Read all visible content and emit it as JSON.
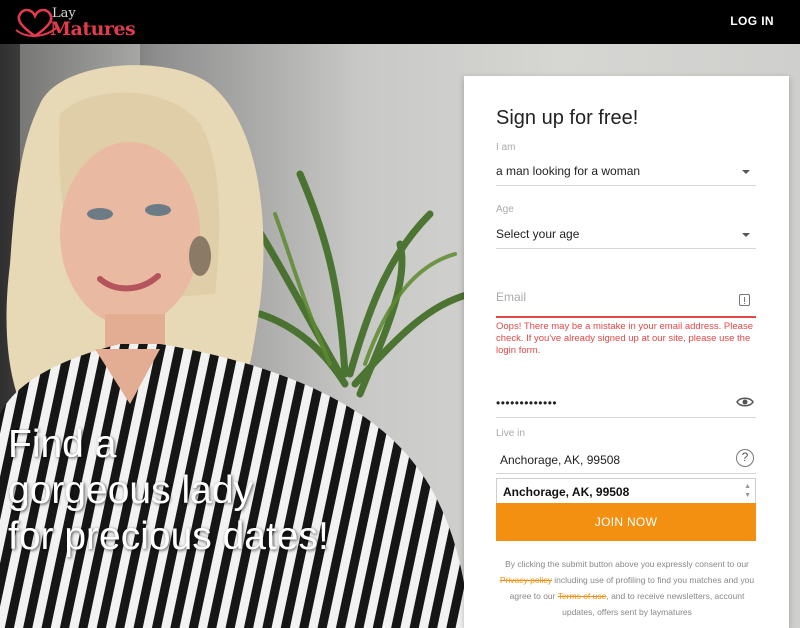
{
  "header": {
    "brand_top": "Lay",
    "brand_bottom": "Matures",
    "login_label": "LOG IN"
  },
  "hero": {
    "tagline": [
      "Find a",
      "gorgeous lady",
      "for precious dates!"
    ]
  },
  "form": {
    "title": "Sign up for free!",
    "i_am_label": "I am",
    "i_am_value": "a man looking for a woman",
    "age_label": "Age",
    "age_value": "Select your age",
    "email_placeholder": "Email",
    "email_error": "Oops! There may be a mistake in your email address. Please check. If you've already signed up at our site, please use the login form.",
    "password_value": "•••••••••••••",
    "live_in_label": "Live in",
    "location_value": "Anchorage, AK, 99508",
    "location_option": "Anchorage, AK, 99508",
    "join_label": "JOIN NOW",
    "consent_prefix": "By clicking the submit button above you expressly consent to our ",
    "privacy_link": "Privacy policy",
    "consent_mid": " including use of profiling to find you matches and you agree to our ",
    "terms_link": "Terms of use",
    "consent_suffix": ", and to receive newsletters, account updates, offers sent by laymatures"
  },
  "colors": {
    "accent": "#f39012",
    "error": "#e04848",
    "brand_red": "#e23b4e"
  },
  "icons": [
    "heart-logo-icon",
    "caret-down-icon",
    "alert-icon",
    "eye-icon",
    "help-icon",
    "spinner-arrows-icon"
  ]
}
